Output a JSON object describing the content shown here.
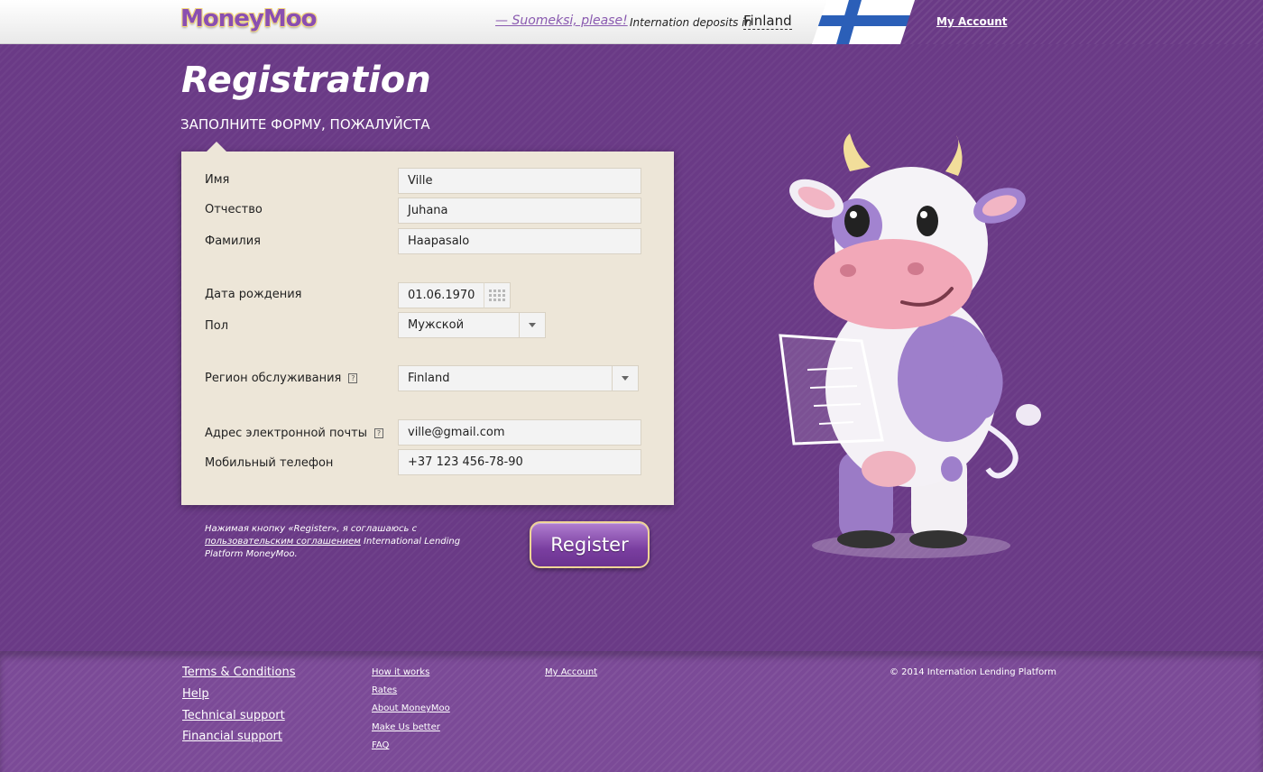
{
  "header": {
    "logo": "MoneyMoo",
    "lang_link": "— Suomeksi, please!",
    "deposits_label": "Internation deposits in",
    "country": "Finland",
    "my_account": "My Account"
  },
  "page": {
    "title": "Registration",
    "subtitle": "ЗАПОЛНИТЕ ФОРМУ, ПОЖАЛУЙСТА"
  },
  "form": {
    "first_name": {
      "label": "Имя",
      "value": "Ville"
    },
    "patronymic": {
      "label": "Отчество",
      "value": "Juhana"
    },
    "last_name": {
      "label": "Фамилия",
      "value": "Haapasalo"
    },
    "birth_date": {
      "label": "Дата рождения",
      "value": "01.06.1970"
    },
    "gender": {
      "label": "Пол",
      "value": "Мужской"
    },
    "region": {
      "label": "Регион обслуживания",
      "value": "Finland"
    },
    "email": {
      "label": "Адрес электронной почты",
      "value": "ville@gmail.com"
    },
    "phone": {
      "label": "Мобильный телефон",
      "value": "+37 123 456-78-90"
    },
    "help_glyph": "?"
  },
  "agreement": {
    "prefix": "Нажимая кнопку «Register», я соглашаюсь с",
    "link": "пользовательским соглашением",
    "suffix": "International Lending Platform MoneyMoo."
  },
  "register_button": "Register",
  "footer": {
    "col1": [
      "Terms & Conditions",
      "Help",
      "Technical support",
      "Financial support"
    ],
    "col2": [
      "How it works",
      "Rates",
      "About MoneyMoo",
      "Make Us better",
      "FAQ"
    ],
    "col3": [
      "My Account"
    ],
    "copyright": "© 2014 Internation Lending Platform"
  },
  "colors": {
    "background": "#6a3a86",
    "form_panel": "#ede6d8",
    "button_border": "#f0d596"
  }
}
